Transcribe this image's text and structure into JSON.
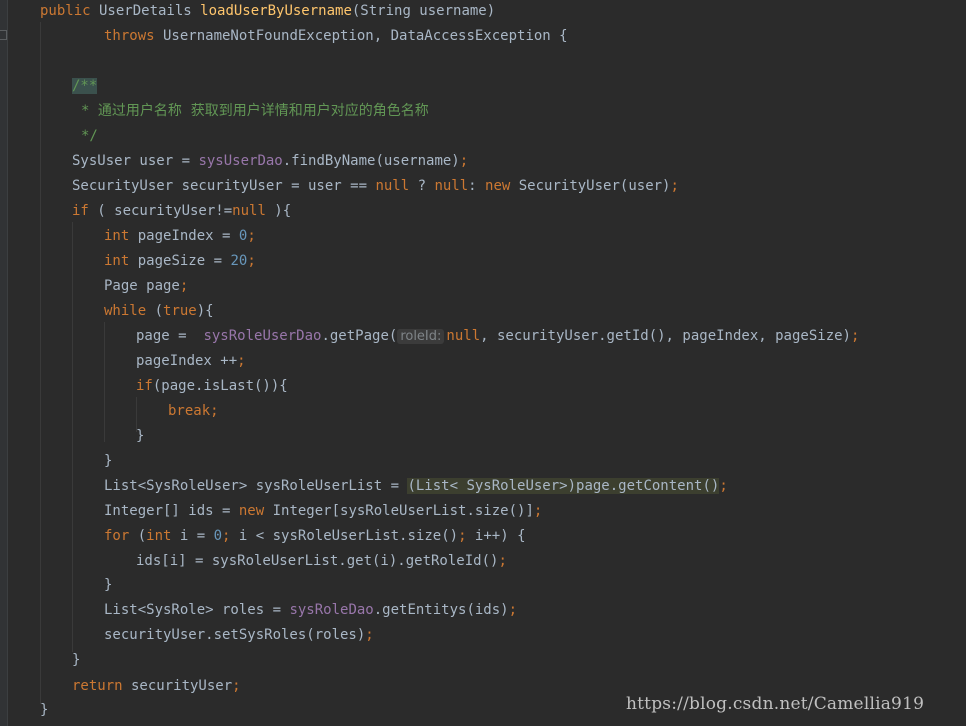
{
  "code": {
    "l1": {
      "kw": "public",
      "type": " UserDetails ",
      "fn": "loadUserByUsername",
      "rest": "(String username)"
    },
    "l2": {
      "kw": "throws",
      "rest": " UsernameNotFoundException, DataAccessException {"
    },
    "l4": {
      "open": "/**"
    },
    "l5": {
      "star": "* ",
      "text": "通过用户名称  获取到用户详情和用户对应的角色名称"
    },
    "l6": {
      "close": "*/"
    },
    "l7": {
      "a": "SysUser user = ",
      "fld": "sysUserDao",
      "b": ".findByName(username)",
      "semi": ";"
    },
    "l8": {
      "a": "SecurityUser securityUser = user == ",
      "n1": "null",
      "b": " ? ",
      "n2": "null",
      "c": ": ",
      "kw": "new",
      "d": " SecurityUser(user)",
      "semi": ";"
    },
    "l9": {
      "kw": "if",
      "a": " ( securityUser!=",
      "n": "null",
      "b": " ){"
    },
    "l10": {
      "kw": "int",
      "a": " pageIndex = ",
      "num": "0",
      "semi": ";"
    },
    "l11": {
      "kw": "int",
      "a": " pageSize = ",
      "num": "20",
      "semi": ";"
    },
    "l12": {
      "a": "Page page",
      "semi": ";"
    },
    "l13": {
      "kw": "while",
      "a": " (",
      "t": "true",
      "b": "){"
    },
    "l14": {
      "a": "page =  ",
      "fld": "sysRoleUserDao",
      "b": ".getPage(",
      "hint": "roleId:",
      "n": "null",
      "c": ", securityUser.getId(), pageIndex, pageSize)",
      "semi": ";"
    },
    "l15": {
      "a": "pageIndex ++",
      "semi": ";"
    },
    "l16": {
      "kw": "if",
      "a": "(page.isLast()){"
    },
    "l17": {
      "kw": "break",
      "semi": ";"
    },
    "l18": {
      "a": "}"
    },
    "l19": {
      "a": "}"
    },
    "l20": {
      "a": "List<SysRoleUser> sysRoleUserList = ",
      "cast": "(List< SysRoleUser>)",
      "b": "page.getContent()",
      "semi": ";"
    },
    "l21": {
      "a": "Integer[] ids = ",
      "kw": "new",
      "b": " Integer[sysRoleUserList.size()]",
      "semi": ";"
    },
    "l22": {
      "kw": "for",
      "a": " (",
      "kw2": "int",
      "b": " i = ",
      "num": "0",
      "semi1": ";",
      "c": " i < sysRoleUserList.size()",
      "semi2": ";",
      "d": " i++) {"
    },
    "l23": {
      "a": "ids[i] = sysRoleUserList.get(i).getRoleId()",
      "semi": ";"
    },
    "l24": {
      "a": "}"
    },
    "l25": {
      "a": "List<SysRole> roles = ",
      "fld": "sysRoleDao",
      "b": ".getEntitys(ids)",
      "semi": ";"
    },
    "l26": {
      "a": "securityUser.setSysRoles(roles)",
      "semi": ";"
    },
    "l27": {
      "a": "}"
    },
    "l28": {
      "kw": "return",
      "a": " securityUser",
      "semi": ";"
    },
    "l29": {
      "a": "}"
    }
  },
  "watermark": "https://blog.csdn.net/Camellia919"
}
